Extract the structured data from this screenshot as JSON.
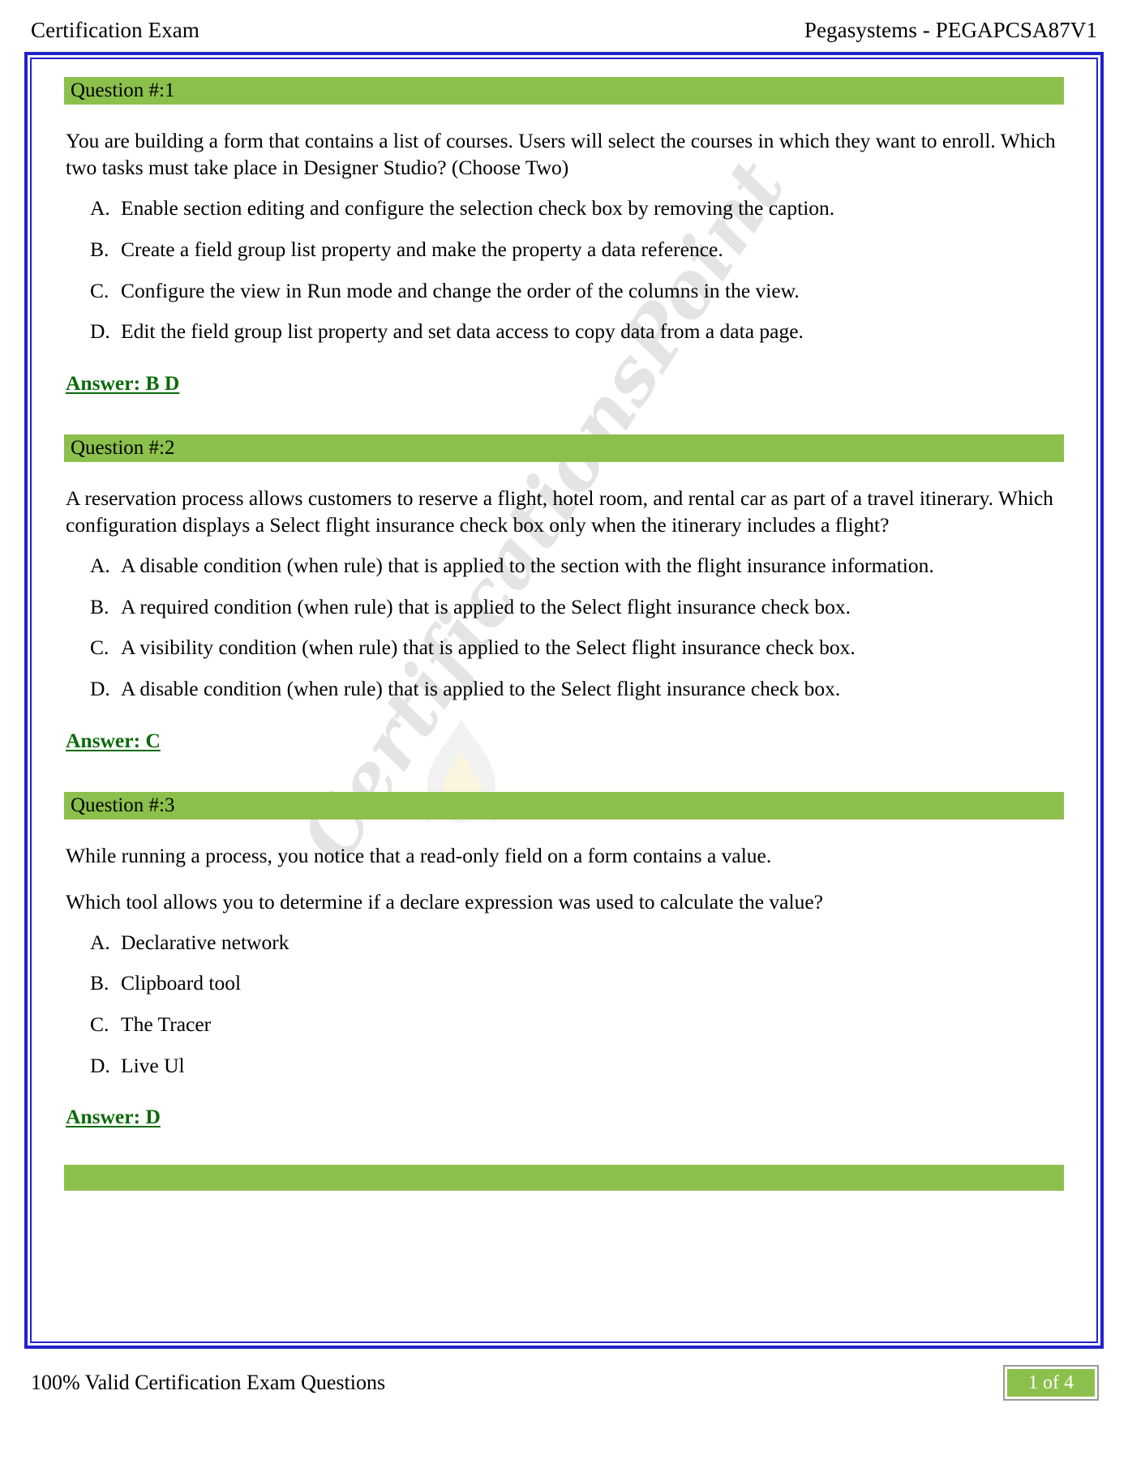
{
  "header": {
    "left_title": "Certification Exam",
    "right_title": "Pegasystems - PEGAPCSA87V1"
  },
  "watermark": {
    "text": "CertificationsPoint"
  },
  "colors": {
    "question_bar_green": "#8cc04c",
    "answer_green": "#0a6b0a",
    "frame_blue": "#2222cc",
    "badge_green": "#8cc04c"
  },
  "questions": [
    {
      "header": "Question #:1",
      "stem": [
        "You are building a form that contains a list of courses. Users will select the courses in which they want to enroll. Which two tasks must take place in Designer Studio? (Choose Two)"
      ],
      "options": [
        {
          "letter": "A.",
          "text": "Enable section editing and configure the selection check box by removing the caption."
        },
        {
          "letter": "B.",
          "text": "Create a field group list property and make the property a data reference."
        },
        {
          "letter": "C.",
          "text": "Configure the view in Run mode and change the order of the columns in the view."
        },
        {
          "letter": "D.",
          "text": "Edit the field group list property and set data access to copy data from a data page."
        }
      ],
      "answer": "Answer: B D"
    },
    {
      "header": "Question #:2",
      "stem": [
        "A reservation process allows customers to reserve a flight, hotel room, and rental car as part of a travel itinerary. Which configuration displays a Select flight insurance check box only when the itinerary includes a flight?"
      ],
      "options": [
        {
          "letter": "A.",
          "text": "A disable condition (when rule) that is applied to the section with the flight insurance information."
        },
        {
          "letter": "B.",
          "text": "A required condition (when rule) that is applied to the Select flight insurance check box."
        },
        {
          "letter": "C.",
          "text": "A visibility condition (when rule) that is applied to the Select flight insurance check box."
        },
        {
          "letter": "D.",
          "text": "A disable condition (when rule) that is applied to the Select flight insurance check box."
        }
      ],
      "answer": "Answer: C"
    },
    {
      "header": "Question #:3",
      "stem": [
        "While running a process, you notice that a read-only field on a form contains a value.",
        "Which tool allows you to determine if a declare expression was used to calculate the value?"
      ],
      "options": [
        {
          "letter": "A.",
          "text": "Declarative network"
        },
        {
          "letter": "B.",
          "text": "Clipboard tool"
        },
        {
          "letter": "C.",
          "text": "The Tracer"
        },
        {
          "letter": "D.",
          "text": "Live Ul"
        }
      ],
      "answer": "Answer: D"
    }
  ],
  "footer": {
    "left_text": "100% Valid Certification Exam Questions",
    "page_badge": "1 of 4"
  }
}
